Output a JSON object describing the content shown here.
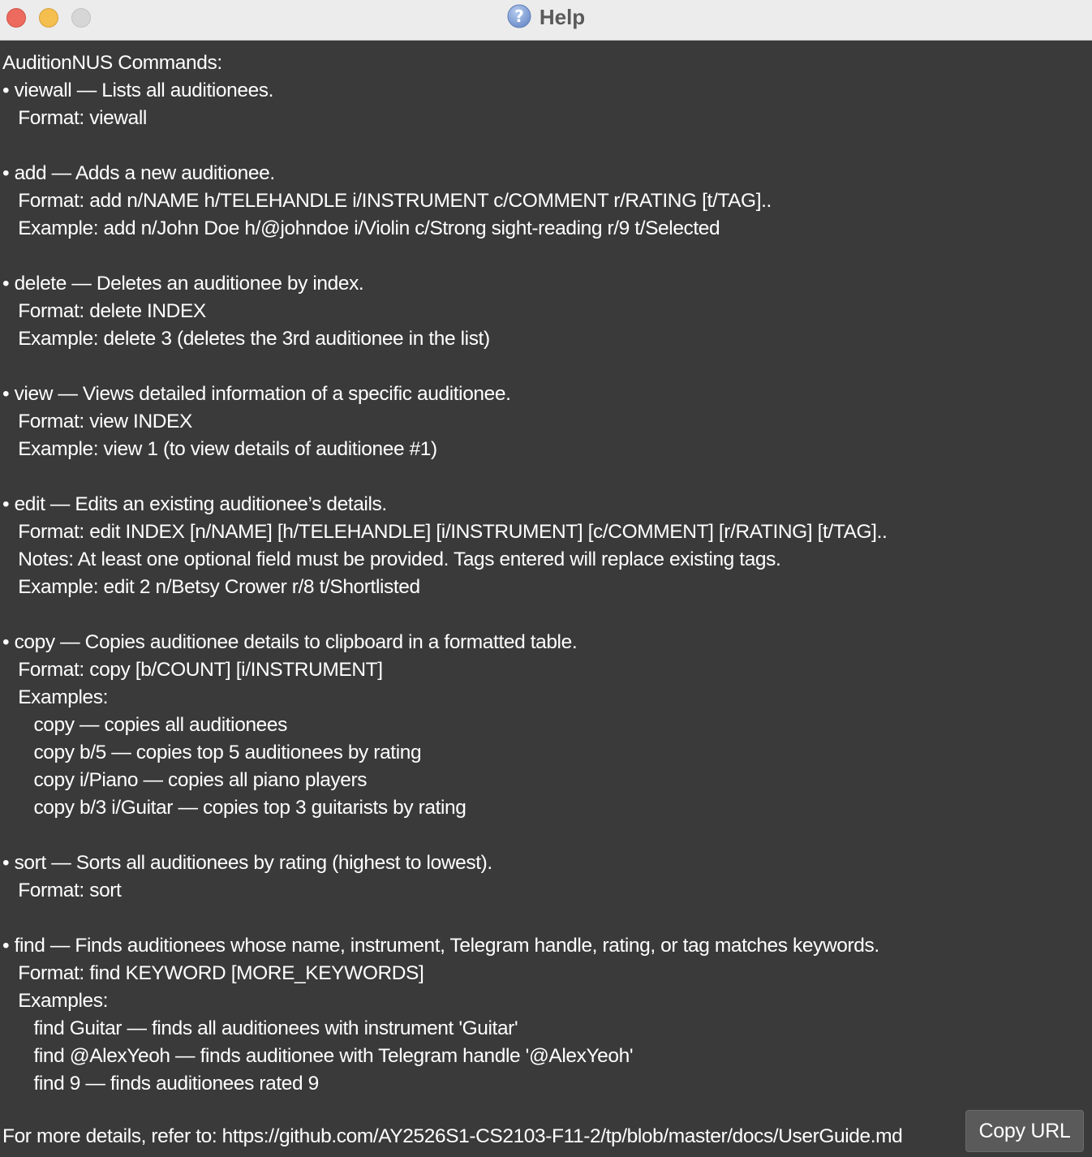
{
  "window": {
    "title": "Help",
    "icon": "question-circle-icon",
    "controls": [
      "close",
      "minimize",
      "zoom"
    ]
  },
  "help": {
    "text": "AuditionNUS Commands:\n• viewall — Lists all auditionees.\n   Format: viewall\n\n• add — Adds a new auditionee.\n   Format: add n/NAME h/TELEHANDLE i/INSTRUMENT c/COMMENT r/RATING [t/TAG]..\n   Example: add n/John Doe h/@johndoe i/Violin c/Strong sight-reading r/9 t/Selected\n\n• delete — Deletes an auditionee by index.\n   Format: delete INDEX\n   Example: delete 3 (deletes the 3rd auditionee in the list)\n\n• view — Views detailed information of a specific auditionee.\n   Format: view INDEX\n   Example: view 1 (to view details of auditionee #1)\n\n• edit — Edits an existing auditionee’s details.\n   Format: edit INDEX [n/NAME] [h/TELEHANDLE] [i/INSTRUMENT] [c/COMMENT] [r/RATING] [t/TAG]..\n   Notes: At least one optional field must be provided. Tags entered will replace existing tags.\n   Example: edit 2 n/Betsy Crower r/8 t/Shortlisted\n\n• copy — Copies auditionee details to clipboard in a formatted table.\n   Format: copy [b/COUNT] [i/INSTRUMENT]\n   Examples:\n      copy — copies all auditionees\n      copy b/5 — copies top 5 auditionees by rating\n      copy i/Piano — copies all piano players\n      copy b/3 i/Guitar — copies top 3 guitarists by rating\n\n• sort — Sorts all auditionees by rating (highest to lowest).\n   Format: sort\n\n• find — Finds auditionees whose name, instrument, Telegram handle, rating, or tag matches keywords.\n   Format: find KEYWORD [MORE_KEYWORDS]\n   Examples:\n      find Guitar — finds all auditionees with instrument 'Guitar'\n      find @AlexYeoh — finds auditionee with Telegram handle '@AlexYeoh'\n      find 9 — finds auditionees rated 9",
    "footer": "For more details, refer to: https://github.com/AY2526S1-CS2103-F11-2/tp/blob/master/docs/UserGuide.md",
    "copy_button_label": "Copy URL"
  }
}
